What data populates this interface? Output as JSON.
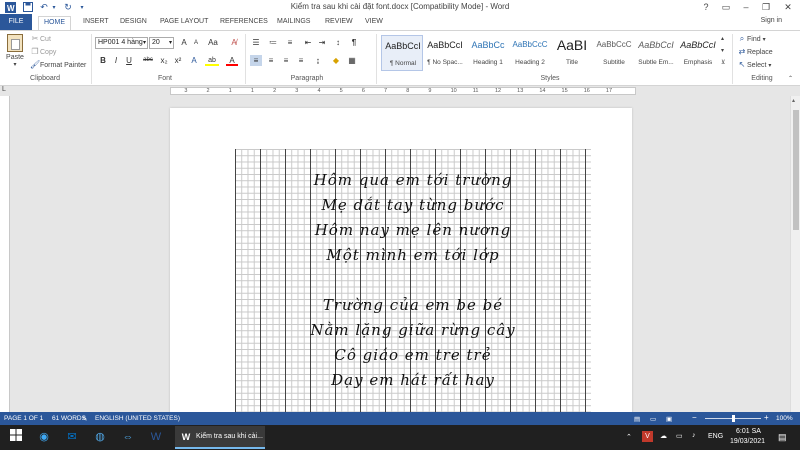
{
  "window": {
    "title": "Kiểm tra sau khi cài đặt font.docx [Compatibility Mode] - Word",
    "help": "?",
    "sign_in": "Sign in"
  },
  "tabs": [
    "FILE",
    "HOME",
    "INSERT",
    "DESIGN",
    "PAGE LAYOUT",
    "REFERENCES",
    "MAILINGS",
    "REVIEW",
    "VIEW"
  ],
  "ribbon": {
    "clipboard": {
      "label": "Clipboard",
      "paste": "Paste",
      "cut": "Cut",
      "copy": "Copy",
      "format_painter": "Format Painter"
    },
    "font": {
      "label": "Font",
      "name": "HP001 4 hàng",
      "size": "20",
      "grow": "A",
      "shrink": "A",
      "case": "Aa",
      "bold": "B",
      "italic": "I",
      "underline": "U",
      "strike": "abc",
      "sub": "x₂",
      "sup": "x²",
      "font_color": "A",
      "highlight": "ab"
    },
    "paragraph": {
      "label": "Paragraph"
    },
    "styles": {
      "label": "Styles",
      "items": [
        {
          "sample": "AaBbCcI",
          "name": "¶ Normal"
        },
        {
          "sample": "AaBbCcI",
          "name": "¶ No Spac..."
        },
        {
          "sample": "AaBbCc",
          "name": "Heading 1"
        },
        {
          "sample": "AaBbCcC",
          "name": "Heading 2"
        },
        {
          "sample": "AaBI",
          "name": "Title"
        },
        {
          "sample": "AaBbCcC",
          "name": "Subtitle"
        },
        {
          "sample": "AaBbCcI",
          "name": "Subtle Em..."
        },
        {
          "sample": "AaBbCcI",
          "name": "Emphasis"
        }
      ]
    },
    "editing": {
      "label": "Editing",
      "find": "Find",
      "replace": "Replace",
      "select": "Select"
    }
  },
  "ruler": {
    "numbers": [
      "3",
      "2",
      "1",
      "1",
      "2",
      "3",
      "4",
      "5",
      "6",
      "7",
      "8",
      "9",
      "10",
      "11",
      "12",
      "13",
      "14",
      "15",
      "16",
      "17"
    ]
  },
  "document": {
    "lines": [
      "Hôm qua em tới trường",
      "Mẹ dắt tay từng bước",
      "Hôm nay mẹ lên nương",
      "Một mình em tới lớp",
      "",
      "Trường của em be bé",
      "Nằm lặng giữa rừng cây",
      "Cô giáo em tre trẻ",
      "Dạy em hát rất hay"
    ]
  },
  "status": {
    "page": "PAGE 1 OF 1",
    "words": "61 WORDS",
    "language": "ENGLISH (UNITED STATES)",
    "zoom_minus": "−",
    "zoom_plus": "+",
    "zoom": "100%",
    "zoom_level": 1.0
  },
  "taskbar": {
    "word_label": "Kiểm tra sau khi cài...",
    "lang": "ENG",
    "time": "6:01 SA",
    "date": "19/03/2021"
  },
  "colors": {
    "accent": "#2b579a",
    "taskbar": "#202020"
  }
}
